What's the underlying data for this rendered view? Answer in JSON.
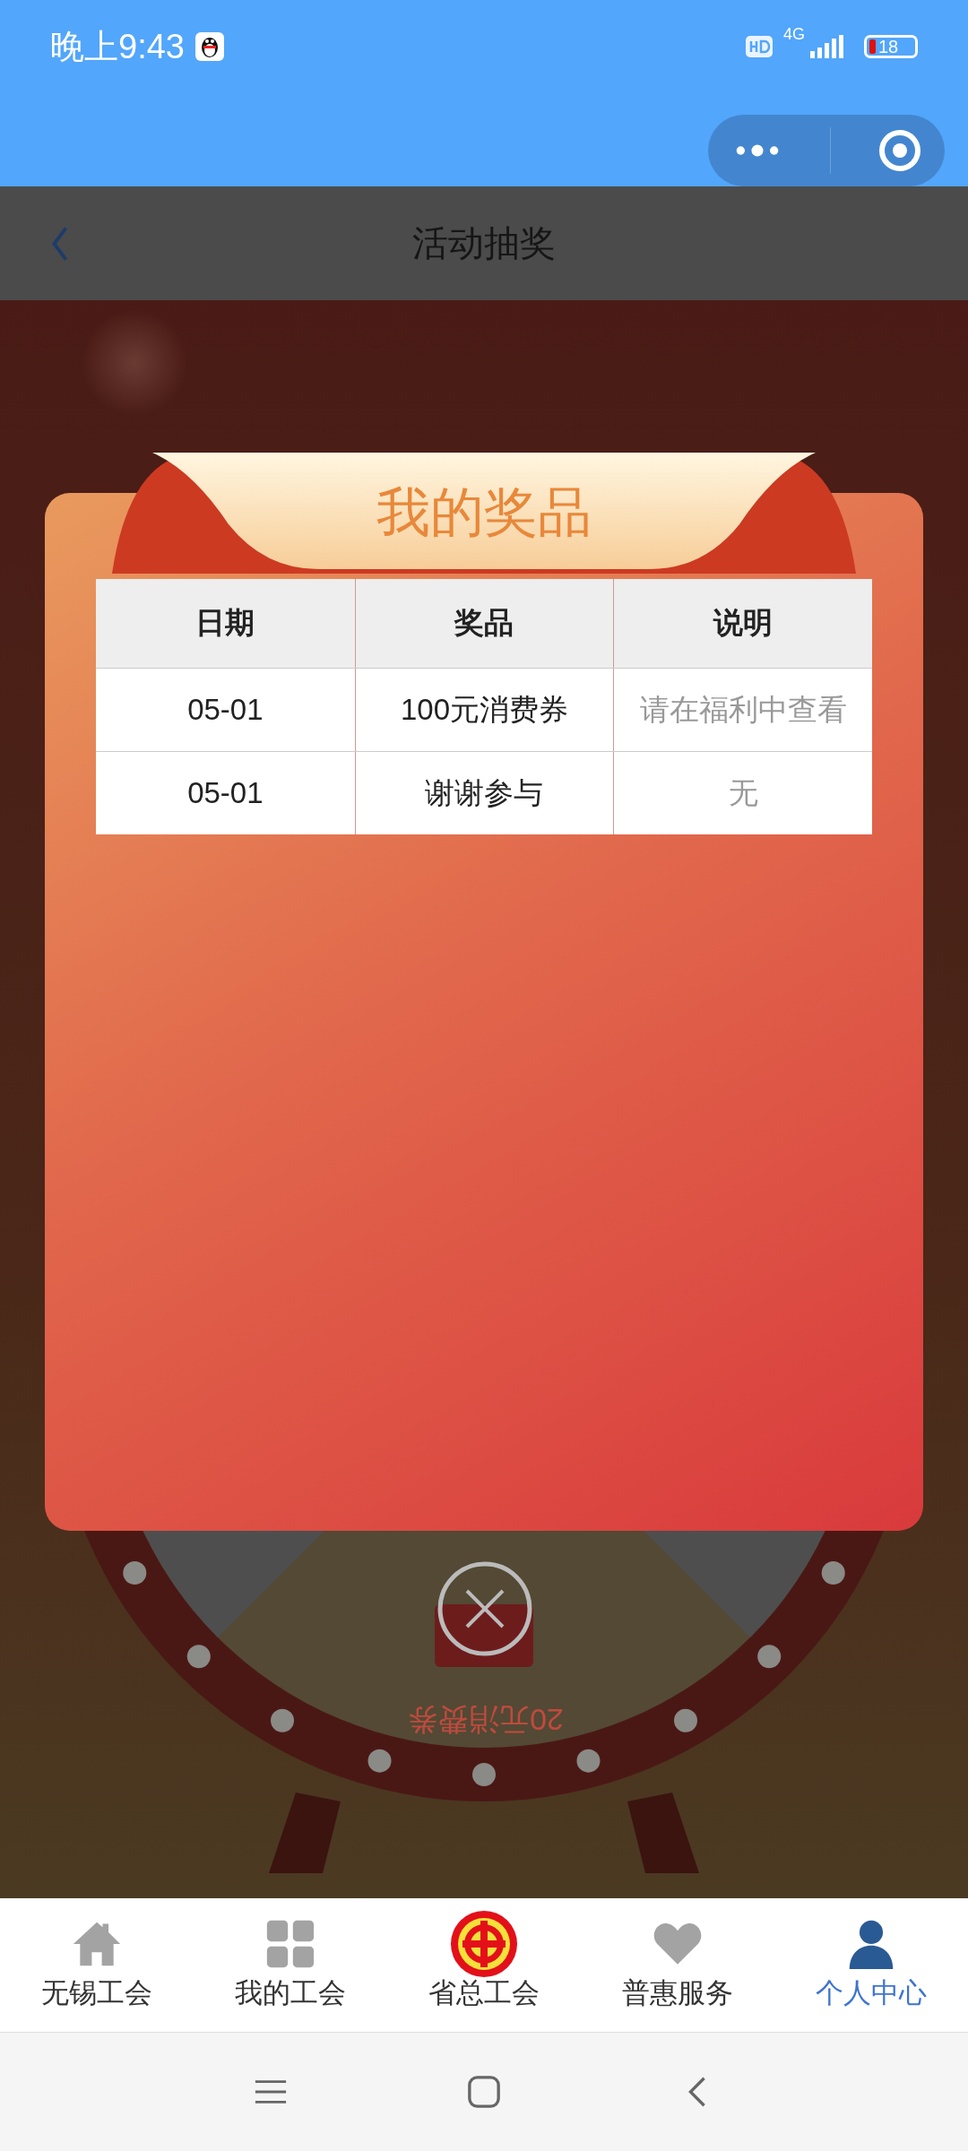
{
  "status_bar": {
    "time": "晚上9:43",
    "network": "4G",
    "battery": "18"
  },
  "header": {
    "title": "活动抽奖"
  },
  "background": {
    "wheel_prize": "20元消费券"
  },
  "modal": {
    "title": "我的奖品",
    "columns": [
      "日期",
      "奖品",
      "说明"
    ],
    "rows": [
      [
        "05-01",
        "100元消费券",
        "请在福利中查看"
      ],
      [
        "05-01",
        "谢谢参与",
        "无"
      ]
    ]
  },
  "tab_bar": [
    {
      "label": "无锡工会",
      "kind": "home",
      "selected": false
    },
    {
      "label": "我的工会",
      "kind": "grid",
      "selected": false
    },
    {
      "label": "省总工会",
      "kind": "logo",
      "selected": false
    },
    {
      "label": "普惠服务",
      "kind": "heart",
      "selected": false
    },
    {
      "label": "个人中心",
      "kind": "person",
      "selected": true
    }
  ]
}
